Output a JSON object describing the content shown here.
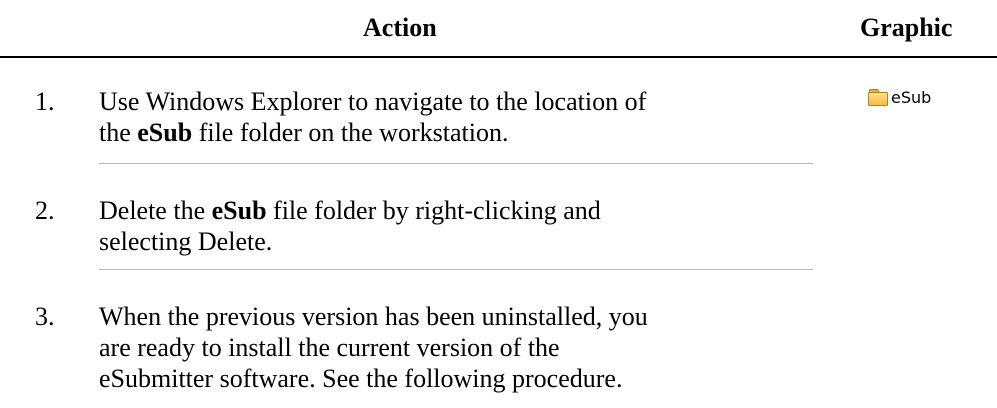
{
  "header": {
    "action_label": "Action",
    "graphic_label": "Graphic"
  },
  "steps": [
    {
      "number": "1.",
      "text_html": "Use Windows Explorer to navigate to the location of<br>the <b>eSub</b> file folder on the workstation."
    },
    {
      "number": "2.",
      "text_html": "Delete the <b>eSub</b> file folder by right-clicking and<br>selecting Delete."
    },
    {
      "number": "3.",
      "text_html": "When the previous version has been uninstalled, you<br>are ready to install the current version of the<br>eSubmitter software. See the following procedure."
    }
  ],
  "graphic": {
    "icon": "folder-icon",
    "label": "eSub"
  }
}
